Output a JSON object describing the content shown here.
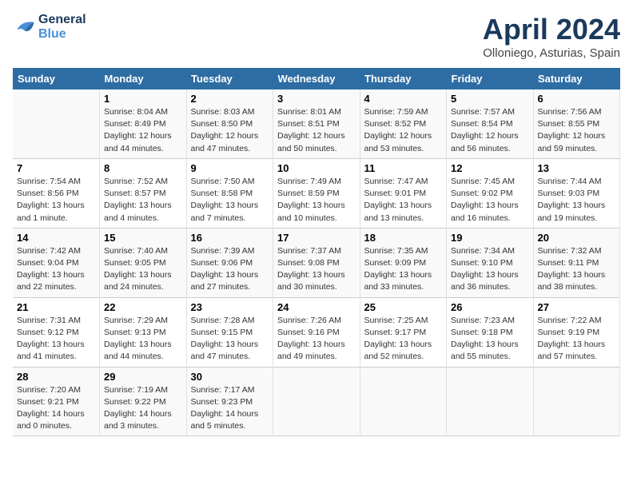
{
  "header": {
    "logo_line1": "General",
    "logo_line2": "Blue",
    "month": "April 2024",
    "location": "Olloniego, Asturias, Spain"
  },
  "weekdays": [
    "Sunday",
    "Monday",
    "Tuesday",
    "Wednesday",
    "Thursday",
    "Friday",
    "Saturday"
  ],
  "weeks": [
    [
      {
        "day": "",
        "info": ""
      },
      {
        "day": "1",
        "info": "Sunrise: 8:04 AM\nSunset: 8:49 PM\nDaylight: 12 hours\nand 44 minutes."
      },
      {
        "day": "2",
        "info": "Sunrise: 8:03 AM\nSunset: 8:50 PM\nDaylight: 12 hours\nand 47 minutes."
      },
      {
        "day": "3",
        "info": "Sunrise: 8:01 AM\nSunset: 8:51 PM\nDaylight: 12 hours\nand 50 minutes."
      },
      {
        "day": "4",
        "info": "Sunrise: 7:59 AM\nSunset: 8:52 PM\nDaylight: 12 hours\nand 53 minutes."
      },
      {
        "day": "5",
        "info": "Sunrise: 7:57 AM\nSunset: 8:54 PM\nDaylight: 12 hours\nand 56 minutes."
      },
      {
        "day": "6",
        "info": "Sunrise: 7:56 AM\nSunset: 8:55 PM\nDaylight: 12 hours\nand 59 minutes."
      }
    ],
    [
      {
        "day": "7",
        "info": "Sunrise: 7:54 AM\nSunset: 8:56 PM\nDaylight: 13 hours\nand 1 minute."
      },
      {
        "day": "8",
        "info": "Sunrise: 7:52 AM\nSunset: 8:57 PM\nDaylight: 13 hours\nand 4 minutes."
      },
      {
        "day": "9",
        "info": "Sunrise: 7:50 AM\nSunset: 8:58 PM\nDaylight: 13 hours\nand 7 minutes."
      },
      {
        "day": "10",
        "info": "Sunrise: 7:49 AM\nSunset: 8:59 PM\nDaylight: 13 hours\nand 10 minutes."
      },
      {
        "day": "11",
        "info": "Sunrise: 7:47 AM\nSunset: 9:01 PM\nDaylight: 13 hours\nand 13 minutes."
      },
      {
        "day": "12",
        "info": "Sunrise: 7:45 AM\nSunset: 9:02 PM\nDaylight: 13 hours\nand 16 minutes."
      },
      {
        "day": "13",
        "info": "Sunrise: 7:44 AM\nSunset: 9:03 PM\nDaylight: 13 hours\nand 19 minutes."
      }
    ],
    [
      {
        "day": "14",
        "info": "Sunrise: 7:42 AM\nSunset: 9:04 PM\nDaylight: 13 hours\nand 22 minutes."
      },
      {
        "day": "15",
        "info": "Sunrise: 7:40 AM\nSunset: 9:05 PM\nDaylight: 13 hours\nand 24 minutes."
      },
      {
        "day": "16",
        "info": "Sunrise: 7:39 AM\nSunset: 9:06 PM\nDaylight: 13 hours\nand 27 minutes."
      },
      {
        "day": "17",
        "info": "Sunrise: 7:37 AM\nSunset: 9:08 PM\nDaylight: 13 hours\nand 30 minutes."
      },
      {
        "day": "18",
        "info": "Sunrise: 7:35 AM\nSunset: 9:09 PM\nDaylight: 13 hours\nand 33 minutes."
      },
      {
        "day": "19",
        "info": "Sunrise: 7:34 AM\nSunset: 9:10 PM\nDaylight: 13 hours\nand 36 minutes."
      },
      {
        "day": "20",
        "info": "Sunrise: 7:32 AM\nSunset: 9:11 PM\nDaylight: 13 hours\nand 38 minutes."
      }
    ],
    [
      {
        "day": "21",
        "info": "Sunrise: 7:31 AM\nSunset: 9:12 PM\nDaylight: 13 hours\nand 41 minutes."
      },
      {
        "day": "22",
        "info": "Sunrise: 7:29 AM\nSunset: 9:13 PM\nDaylight: 13 hours\nand 44 minutes."
      },
      {
        "day": "23",
        "info": "Sunrise: 7:28 AM\nSunset: 9:15 PM\nDaylight: 13 hours\nand 47 minutes."
      },
      {
        "day": "24",
        "info": "Sunrise: 7:26 AM\nSunset: 9:16 PM\nDaylight: 13 hours\nand 49 minutes."
      },
      {
        "day": "25",
        "info": "Sunrise: 7:25 AM\nSunset: 9:17 PM\nDaylight: 13 hours\nand 52 minutes."
      },
      {
        "day": "26",
        "info": "Sunrise: 7:23 AM\nSunset: 9:18 PM\nDaylight: 13 hours\nand 55 minutes."
      },
      {
        "day": "27",
        "info": "Sunrise: 7:22 AM\nSunset: 9:19 PM\nDaylight: 13 hours\nand 57 minutes."
      }
    ],
    [
      {
        "day": "28",
        "info": "Sunrise: 7:20 AM\nSunset: 9:21 PM\nDaylight: 14 hours\nand 0 minutes."
      },
      {
        "day": "29",
        "info": "Sunrise: 7:19 AM\nSunset: 9:22 PM\nDaylight: 14 hours\nand 3 minutes."
      },
      {
        "day": "30",
        "info": "Sunrise: 7:17 AM\nSunset: 9:23 PM\nDaylight: 14 hours\nand 5 minutes."
      },
      {
        "day": "",
        "info": ""
      },
      {
        "day": "",
        "info": ""
      },
      {
        "day": "",
        "info": ""
      },
      {
        "day": "",
        "info": ""
      }
    ]
  ]
}
